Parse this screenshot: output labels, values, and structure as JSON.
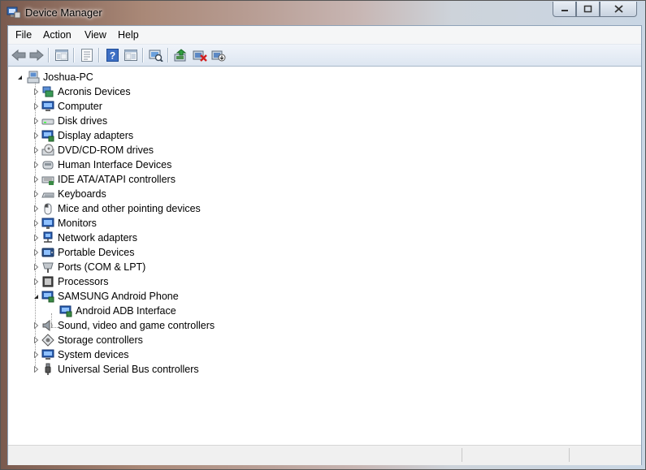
{
  "window": {
    "title": "Device Manager"
  },
  "menu": [
    "File",
    "Action",
    "View",
    "Help"
  ],
  "toolbar": [
    "back-arrow-icon",
    "forward-arrow-icon",
    "console-tree-icon",
    "properties-icon",
    "help-icon",
    "show-hide-icon",
    "scan-hardware-icon",
    "update-driver-icon",
    "uninstall-icon",
    "disable-icon"
  ],
  "tree": {
    "root": "Joshua-PC",
    "items": [
      {
        "label": "Acronis Devices",
        "icon": "acronis-devices-icon",
        "expanded": false
      },
      {
        "label": "Computer",
        "icon": "computer-icon",
        "expanded": false
      },
      {
        "label": "Disk drives",
        "icon": "disk-drive-icon",
        "expanded": false
      },
      {
        "label": "Display adapters",
        "icon": "display-adapter-icon",
        "expanded": false
      },
      {
        "label": "DVD/CD-ROM drives",
        "icon": "dvd-drive-icon",
        "expanded": false
      },
      {
        "label": "Human Interface Devices",
        "icon": "hid-icon",
        "expanded": false
      },
      {
        "label": "IDE ATA/ATAPI controllers",
        "icon": "ide-controller-icon",
        "expanded": false
      },
      {
        "label": "Keyboards",
        "icon": "keyboard-icon",
        "expanded": false
      },
      {
        "label": "Mice and other pointing devices",
        "icon": "mouse-icon",
        "expanded": false
      },
      {
        "label": "Monitors",
        "icon": "monitor-icon",
        "expanded": false
      },
      {
        "label": "Network adapters",
        "icon": "network-adapter-icon",
        "expanded": false
      },
      {
        "label": "Portable Devices",
        "icon": "portable-device-icon",
        "expanded": false
      },
      {
        "label": "Ports (COM & LPT)",
        "icon": "port-icon",
        "expanded": false
      },
      {
        "label": "Processors",
        "icon": "processor-icon",
        "expanded": false
      },
      {
        "label": "SAMSUNG Android Phone",
        "icon": "phone-device-icon",
        "expanded": true,
        "children": [
          {
            "label": "Android ADB Interface",
            "icon": "adb-interface-icon"
          }
        ]
      },
      {
        "label": "Sound, video and game controllers",
        "icon": "sound-icon",
        "expanded": false
      },
      {
        "label": "Storage controllers",
        "icon": "storage-controller-icon",
        "expanded": false
      },
      {
        "label": "System devices",
        "icon": "system-device-icon",
        "expanded": false
      },
      {
        "label": "Universal Serial Bus controllers",
        "icon": "usb-icon",
        "expanded": false
      }
    ]
  },
  "colors": {
    "accent": "#1e5aa8",
    "selection": "#3399ff"
  }
}
